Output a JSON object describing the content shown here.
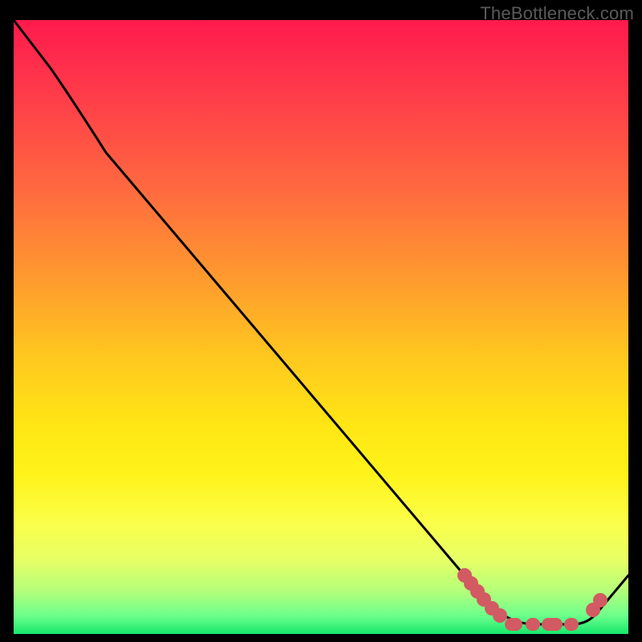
{
  "watermark": "TheBottleneck.com",
  "chart_data": {
    "type": "line",
    "title": "",
    "xlabel": "",
    "ylabel": "",
    "xlim": [
      0,
      100
    ],
    "ylim": [
      0,
      100
    ],
    "grid": false,
    "legend": false,
    "background": "vertical heat gradient (red top → green bottom)",
    "series": [
      {
        "name": "bottleneck-curve",
        "x": [
          0,
          6,
          15,
          30,
          45,
          60,
          73,
          78,
          82,
          86,
          90,
          92,
          95,
          100
        ],
        "values": [
          100,
          92,
          79,
          58,
          38,
          18,
          8,
          4,
          2,
          1,
          1,
          2,
          5,
          10
        ]
      }
    ],
    "highlighted_points": {
      "name": "marked-range",
      "x": [
        73,
        74,
        75,
        76,
        77.5,
        79,
        81,
        83.5,
        86,
        89.5,
        92,
        94.5,
        95.5
      ],
      "values": [
        9,
        8,
        7,
        6,
        4.5,
        3,
        2,
        1.5,
        1,
        1,
        2,
        3.5,
        5
      ]
    },
    "gradient_stops": [
      {
        "pos": 0.0,
        "color": "#ff1a4d"
      },
      {
        "pos": 0.28,
        "color": "#ff6b3f"
      },
      {
        "pos": 0.55,
        "color": "#ffc81f"
      },
      {
        "pos": 0.82,
        "color": "#fbff4a"
      },
      {
        "pos": 1.0,
        "color": "#17e86b"
      }
    ]
  }
}
